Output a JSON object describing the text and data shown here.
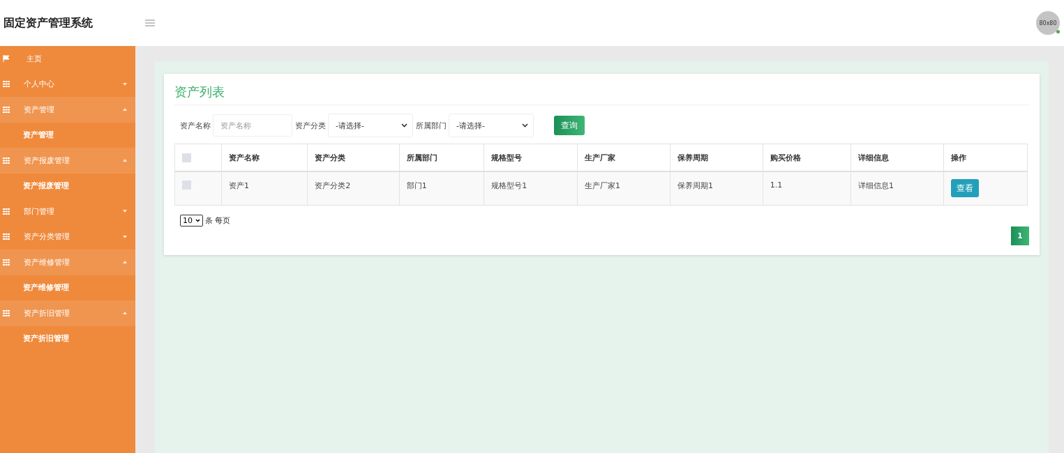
{
  "header": {
    "title": "固定资产管理系统",
    "avatar_text": "80x80",
    "online": true
  },
  "sidebar": {
    "items": [
      {
        "kind": "flag",
        "label": "主页"
      },
      {
        "kind": "grid",
        "label": "个人中心",
        "expanded": false
      },
      {
        "kind": "grid",
        "label": "资产管理",
        "expanded": true,
        "children": [
          {
            "label": "资产管理"
          }
        ]
      },
      {
        "kind": "grid",
        "label": "资产报废管理",
        "expanded": true,
        "children": [
          {
            "label": "资产报废管理"
          }
        ]
      },
      {
        "kind": "grid",
        "label": "部门管理",
        "expanded": false
      },
      {
        "kind": "grid",
        "label": "资产分类管理",
        "expanded": false
      },
      {
        "kind": "grid",
        "label": "资产维修管理",
        "expanded": true,
        "children": [
          {
            "label": "资产维修管理"
          }
        ]
      },
      {
        "kind": "grid",
        "label": "资产折旧管理",
        "expanded": true,
        "children": [
          {
            "label": "资产折旧管理"
          }
        ]
      }
    ]
  },
  "card": {
    "title": "资产列表",
    "filters": [
      {
        "kind": "input",
        "label": "资产名称",
        "placeholder": "资产名称"
      },
      {
        "kind": "select",
        "label": "资产分类",
        "value": "-请选择-"
      },
      {
        "kind": "select",
        "label": "所属部门",
        "value": "-请选择-"
      }
    ],
    "search_button": "查询",
    "table": {
      "all_checked": false,
      "columns": [
        "资产名称",
        "资产分类",
        "所属部门",
        "规格型号",
        "生产厂家",
        "保养周期",
        "购买价格",
        "详细信息",
        "操作"
      ],
      "rows": [
        {
          "checked": false,
          "cells": [
            "资产1",
            "资产分类2",
            "部门1",
            "规格型号1",
            "生产厂家1",
            "保养周期1",
            "1.1",
            "详细信息1"
          ],
          "action": "查看"
        }
      ]
    },
    "page_size": "10",
    "page_size_label": "条 每页",
    "pages": [
      {
        "label": "1",
        "selected": true
      }
    ]
  }
}
